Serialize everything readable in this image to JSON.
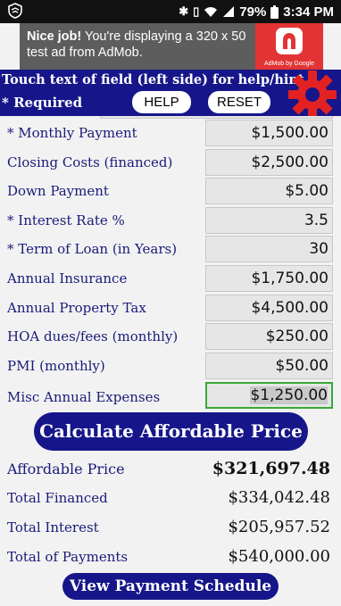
{
  "status_bar": {
    "battery": "79%",
    "time": "3:34 PM",
    "icons": [
      "shield-icon",
      "bluetooth-icon",
      "vibrate-icon",
      "wifi-icon",
      "signal-icon",
      "battery-icon"
    ]
  },
  "ad": {
    "headline": "Nice job!",
    "body": " You're displaying a 320 x 50 test ad from AdMob.",
    "brand": "AdMob by Google"
  },
  "header": {
    "hint": "Touch text of field (left side) for help/hint",
    "required_note": "* Required",
    "help_label": "HELP",
    "reset_label": "RESET",
    "accent": "#16168a"
  },
  "fields": [
    {
      "label": "* Monthly Payment",
      "value": "$1,500.00"
    },
    {
      "label": "Closing Costs (financed)",
      "value": "$2,500.00"
    },
    {
      "label": "Down Payment",
      "value": "$5.00"
    },
    {
      "label": "* Interest Rate %",
      "value": "3.5"
    },
    {
      "label": "* Term of Loan (in Years)",
      "value": "30"
    },
    {
      "label": "Annual Insurance",
      "value": "$1,750.00"
    },
    {
      "label": "Annual Property Tax",
      "value": "$4,500.00"
    },
    {
      "label": "HOA dues/fees (monthly)",
      "value": "$250.00"
    },
    {
      "label": "PMI (monthly)",
      "value": "$50.00"
    },
    {
      "label": "Misc Annual Expenses",
      "value": "$1,250.00"
    }
  ],
  "calculate_label": "Calculate Affordable Price",
  "results": [
    {
      "label": "Affordable Price",
      "value": "$321,697.48"
    },
    {
      "label": "Total Financed",
      "value": "$334,042.48"
    },
    {
      "label": "Total Interest",
      "value": "$205,957.52"
    },
    {
      "label": "Total of Payments",
      "value": "$540,000.00"
    }
  ],
  "schedule_label": "View Payment Schedule"
}
